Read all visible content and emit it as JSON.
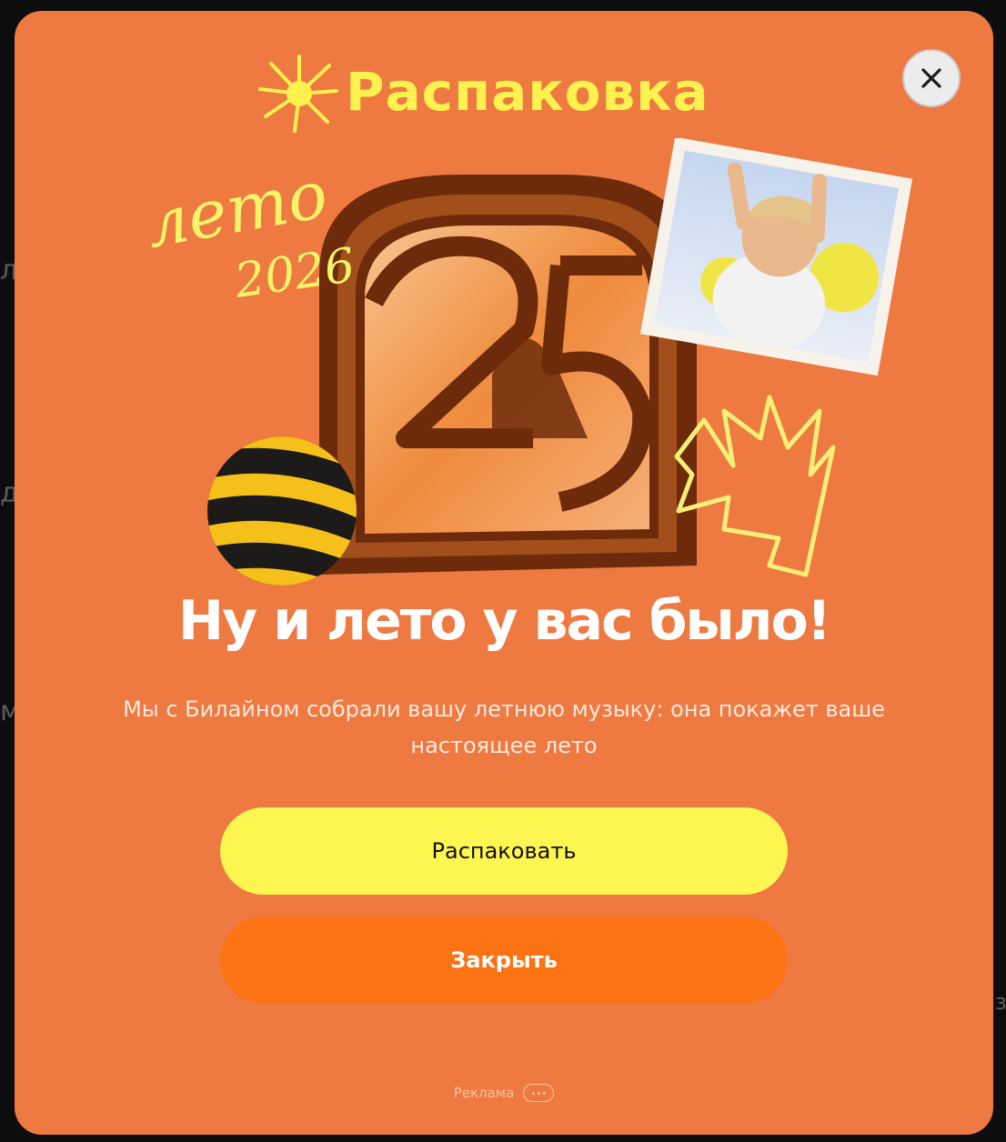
{
  "modal": {
    "brand": "Распаковка",
    "badge": {
      "line1": "лето",
      "line2": "2026"
    },
    "headline": "Ну и лето у вас было!",
    "description": "Мы с Билайном собрали вашу летнюю музыку: она покажет ваше настоящее лето",
    "primary_button": "Распаковать",
    "secondary_button": "Закрыть",
    "ad_label": "Реклама",
    "close_icon": "close-icon",
    "more_icon": "more-dots-icon"
  },
  "colors": {
    "modal_background": "#ee7a41",
    "primary_button": "#fdf651",
    "secondary_button": "#fb7312",
    "brand_yellow": "#fff14e"
  }
}
